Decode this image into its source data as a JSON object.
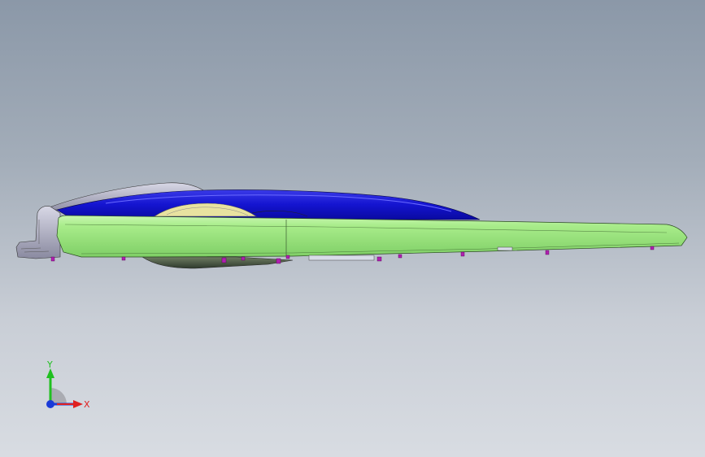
{
  "viewport": {
    "background_top": "#8b98a8",
    "background_bottom": "#d8dce2"
  },
  "model": {
    "body_color": "#a4e884",
    "cover_color": "#1a1ad8",
    "lens_color": "#e8e2a0",
    "bracket_color": "#c8c8d8",
    "underside_color": "#5a6a50",
    "fastener_color": "#b020b0"
  },
  "triad": {
    "x_label": "X",
    "y_label": "Y",
    "x_color": "#e02020",
    "y_color": "#20c020",
    "origin_color": "#1a3ad8"
  }
}
